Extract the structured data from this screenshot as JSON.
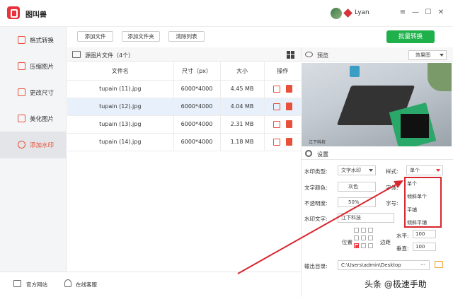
{
  "app": {
    "title": "图叫兽",
    "username": "Lyan"
  },
  "sidebar": {
    "items": [
      {
        "label": "格式转换"
      },
      {
        "label": "压缩图片"
      },
      {
        "label": "更改尺寸"
      },
      {
        "label": "美化图片"
      },
      {
        "label": "添加水印"
      }
    ]
  },
  "toolbar": {
    "add_file": "添加文件",
    "add_folder": "添加文件夹",
    "clear_list": "清除列表",
    "batch_convert": "批量转换"
  },
  "files": {
    "title": "源图片文件（4个）",
    "columns": [
      "文件名",
      "尺寸（px）",
      "大小",
      "操作"
    ],
    "rows": [
      {
        "name": "tupain (11).jpg",
        "size": "6000*4000",
        "bytes": "4.45 MB"
      },
      {
        "name": "tupain (12).jpg",
        "size": "6000*4000",
        "bytes": "4.04 MB"
      },
      {
        "name": "tupain (13).jpg",
        "size": "6000*4000",
        "bytes": "2.31 MB"
      },
      {
        "name": "tupain (14).jpg",
        "size": "6000*4000",
        "bytes": "1.18 MB"
      }
    ]
  },
  "preview": {
    "label": "预览",
    "effect_select": "效果图",
    "watermark_text": "江下科技"
  },
  "settings": {
    "label": "设置",
    "type_label": "水印类型:",
    "type_value": "文字水印",
    "style_label": "样式:",
    "style_value": "单个",
    "color_label": "文字颜色:",
    "color_value": "灰色",
    "font_label": "字体:",
    "opacity_label": "不透明度:",
    "opacity_value": "50%",
    "size_label": "字号:",
    "text_label": "水印文字:",
    "text_value": "江下科技",
    "position_label": "位置",
    "margin_label": "边距",
    "h_label": "水平:",
    "h_value": "100",
    "v_label": "垂直:",
    "v_value": "100",
    "output_label": "输出目录:",
    "output_value": "C:\\Users\\admin\\Desktop",
    "more": "···"
  },
  "style_options": [
    "单个",
    "倾斜单个",
    "平铺",
    "倾斜平铺"
  ],
  "bottom": {
    "website": "官方网站",
    "service": "在线客服"
  },
  "credit": "头条 @极速手助",
  "colors": {
    "accent": "#e8503a",
    "green": "#20b04b",
    "highlight": "#d8262e"
  }
}
